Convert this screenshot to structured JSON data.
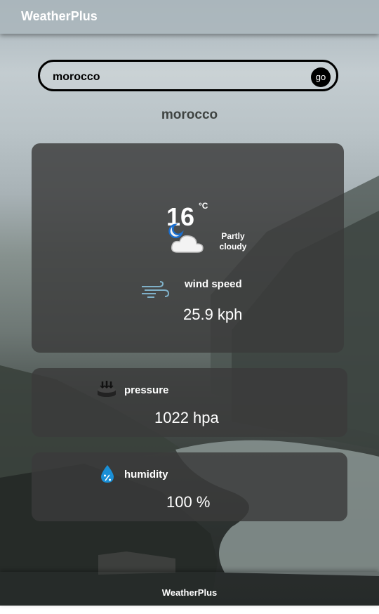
{
  "header": {
    "brand": "WeatherPlus"
  },
  "search": {
    "value": "morocco",
    "button_label": "go"
  },
  "location": {
    "name": "morocco"
  },
  "current": {
    "temperature": "16",
    "unit": "°C",
    "condition": "Partly cloudy",
    "condition_icon": "partly-cloudy-night-icon"
  },
  "wind": {
    "label": "wind speed",
    "value": "25.9 kph",
    "icon": "wind-icon"
  },
  "pressure": {
    "label": "pressure",
    "value": "1022 hpa",
    "icon": "pressure-icon"
  },
  "humidity": {
    "label": "humidity",
    "value": "100 %",
    "icon": "humidity-drop-icon"
  },
  "footer": {
    "text": "WeatherPlus"
  },
  "colors": {
    "accent": "#1a8fd6",
    "card_bg": "#3a3a3a",
    "text": "#ffffff"
  }
}
